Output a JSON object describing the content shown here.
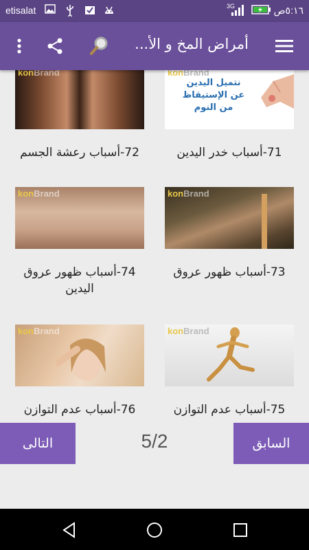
{
  "status_bar": {
    "carrier": "etisalat",
    "network": "3G",
    "time": "٥:١٦ص"
  },
  "app_bar": {
    "title": "أمراض المخ و الأ...",
    "icons": [
      "menu-icon",
      "search-icon",
      "share-icon",
      "overflow-menu-icon"
    ]
  },
  "watermark": {
    "k": "kon",
    "b": "Brand"
  },
  "cards": [
    {
      "caption": "71-أسباب خدر اليدين",
      "image_text": [
        "نتميل اليدين",
        "عن الإستيقاظ",
        "من النوم"
      ]
    },
    {
      "caption": "72-أسباب رعشة الجسم"
    },
    {
      "caption": "73-أسباب ظهور عروق"
    },
    {
      "caption_line1": "74-أسباب ظهور عروق",
      "caption_line2": "اليدين"
    },
    {
      "caption": "75-أسباب عدم التوازن"
    },
    {
      "caption": "76-أسباب عدم التوازن"
    }
  ],
  "pagination": {
    "prev_label": "السابق",
    "next_label": "التالى",
    "page_indicator": "5/2"
  }
}
